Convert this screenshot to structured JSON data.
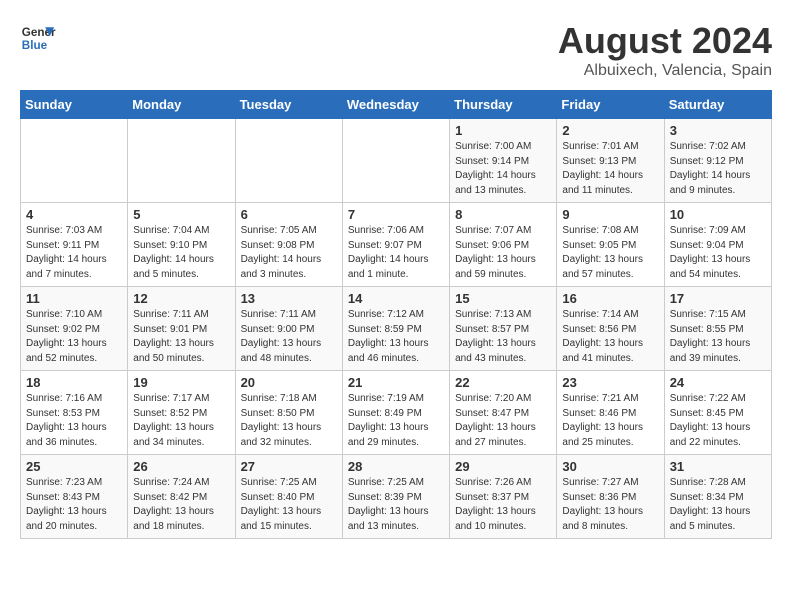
{
  "header": {
    "logo_line1": "General",
    "logo_line2": "Blue",
    "title": "August 2024",
    "subtitle": "Albuixech, Valencia, Spain"
  },
  "days_of_week": [
    "Sunday",
    "Monday",
    "Tuesday",
    "Wednesday",
    "Thursday",
    "Friday",
    "Saturday"
  ],
  "weeks": [
    [
      {
        "day": "",
        "content": ""
      },
      {
        "day": "",
        "content": ""
      },
      {
        "day": "",
        "content": ""
      },
      {
        "day": "",
        "content": ""
      },
      {
        "day": "1",
        "content": "Sunrise: 7:00 AM\nSunset: 9:14 PM\nDaylight: 14 hours\nand 13 minutes."
      },
      {
        "day": "2",
        "content": "Sunrise: 7:01 AM\nSunset: 9:13 PM\nDaylight: 14 hours\nand 11 minutes."
      },
      {
        "day": "3",
        "content": "Sunrise: 7:02 AM\nSunset: 9:12 PM\nDaylight: 14 hours\nand 9 minutes."
      }
    ],
    [
      {
        "day": "4",
        "content": "Sunrise: 7:03 AM\nSunset: 9:11 PM\nDaylight: 14 hours\nand 7 minutes."
      },
      {
        "day": "5",
        "content": "Sunrise: 7:04 AM\nSunset: 9:10 PM\nDaylight: 14 hours\nand 5 minutes."
      },
      {
        "day": "6",
        "content": "Sunrise: 7:05 AM\nSunset: 9:08 PM\nDaylight: 14 hours\nand 3 minutes."
      },
      {
        "day": "7",
        "content": "Sunrise: 7:06 AM\nSunset: 9:07 PM\nDaylight: 14 hours\nand 1 minute."
      },
      {
        "day": "8",
        "content": "Sunrise: 7:07 AM\nSunset: 9:06 PM\nDaylight: 13 hours\nand 59 minutes."
      },
      {
        "day": "9",
        "content": "Sunrise: 7:08 AM\nSunset: 9:05 PM\nDaylight: 13 hours\nand 57 minutes."
      },
      {
        "day": "10",
        "content": "Sunrise: 7:09 AM\nSunset: 9:04 PM\nDaylight: 13 hours\nand 54 minutes."
      }
    ],
    [
      {
        "day": "11",
        "content": "Sunrise: 7:10 AM\nSunset: 9:02 PM\nDaylight: 13 hours\nand 52 minutes."
      },
      {
        "day": "12",
        "content": "Sunrise: 7:11 AM\nSunset: 9:01 PM\nDaylight: 13 hours\nand 50 minutes."
      },
      {
        "day": "13",
        "content": "Sunrise: 7:11 AM\nSunset: 9:00 PM\nDaylight: 13 hours\nand 48 minutes."
      },
      {
        "day": "14",
        "content": "Sunrise: 7:12 AM\nSunset: 8:59 PM\nDaylight: 13 hours\nand 46 minutes."
      },
      {
        "day": "15",
        "content": "Sunrise: 7:13 AM\nSunset: 8:57 PM\nDaylight: 13 hours\nand 43 minutes."
      },
      {
        "day": "16",
        "content": "Sunrise: 7:14 AM\nSunset: 8:56 PM\nDaylight: 13 hours\nand 41 minutes."
      },
      {
        "day": "17",
        "content": "Sunrise: 7:15 AM\nSunset: 8:55 PM\nDaylight: 13 hours\nand 39 minutes."
      }
    ],
    [
      {
        "day": "18",
        "content": "Sunrise: 7:16 AM\nSunset: 8:53 PM\nDaylight: 13 hours\nand 36 minutes."
      },
      {
        "day": "19",
        "content": "Sunrise: 7:17 AM\nSunset: 8:52 PM\nDaylight: 13 hours\nand 34 minutes."
      },
      {
        "day": "20",
        "content": "Sunrise: 7:18 AM\nSunset: 8:50 PM\nDaylight: 13 hours\nand 32 minutes."
      },
      {
        "day": "21",
        "content": "Sunrise: 7:19 AM\nSunset: 8:49 PM\nDaylight: 13 hours\nand 29 minutes."
      },
      {
        "day": "22",
        "content": "Sunrise: 7:20 AM\nSunset: 8:47 PM\nDaylight: 13 hours\nand 27 minutes."
      },
      {
        "day": "23",
        "content": "Sunrise: 7:21 AM\nSunset: 8:46 PM\nDaylight: 13 hours\nand 25 minutes."
      },
      {
        "day": "24",
        "content": "Sunrise: 7:22 AM\nSunset: 8:45 PM\nDaylight: 13 hours\nand 22 minutes."
      }
    ],
    [
      {
        "day": "25",
        "content": "Sunrise: 7:23 AM\nSunset: 8:43 PM\nDaylight: 13 hours\nand 20 minutes."
      },
      {
        "day": "26",
        "content": "Sunrise: 7:24 AM\nSunset: 8:42 PM\nDaylight: 13 hours\nand 18 minutes."
      },
      {
        "day": "27",
        "content": "Sunrise: 7:25 AM\nSunset: 8:40 PM\nDaylight: 13 hours\nand 15 minutes."
      },
      {
        "day": "28",
        "content": "Sunrise: 7:25 AM\nSunset: 8:39 PM\nDaylight: 13 hours\nand 13 minutes."
      },
      {
        "day": "29",
        "content": "Sunrise: 7:26 AM\nSunset: 8:37 PM\nDaylight: 13 hours\nand 10 minutes."
      },
      {
        "day": "30",
        "content": "Sunrise: 7:27 AM\nSunset: 8:36 PM\nDaylight: 13 hours\nand 8 minutes."
      },
      {
        "day": "31",
        "content": "Sunrise: 7:28 AM\nSunset: 8:34 PM\nDaylight: 13 hours\nand 5 minutes."
      }
    ]
  ]
}
